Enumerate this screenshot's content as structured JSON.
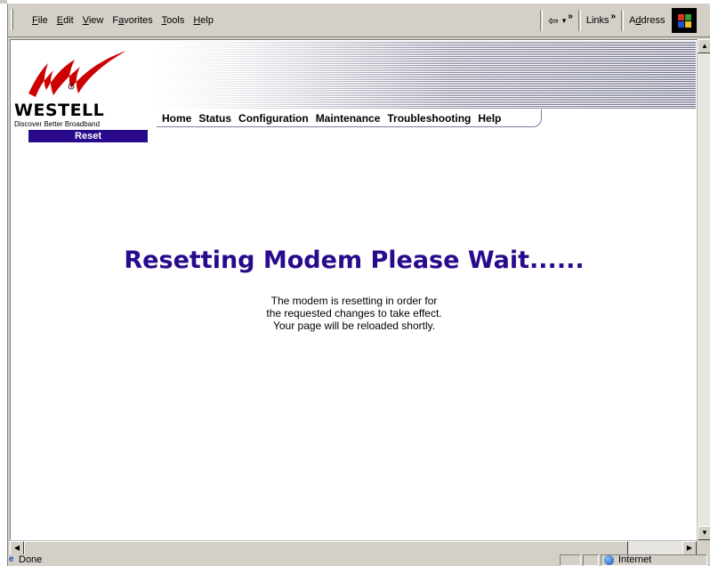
{
  "menu": {
    "items": [
      {
        "pre": "",
        "ul": "F",
        "post": "ile"
      },
      {
        "pre": "",
        "ul": "E",
        "post": "dit"
      },
      {
        "pre": "",
        "ul": "V",
        "post": "iew"
      },
      {
        "pre": "F",
        "ul": "a",
        "post": "vorites"
      },
      {
        "pre": "",
        "ul": "T",
        "post": "ools"
      },
      {
        "pre": "",
        "ul": "H",
        "post": "elp"
      }
    ]
  },
  "toolbar": {
    "back_arrow": "⇦",
    "dropdown_arrow": "▾",
    "chevron": "»",
    "links_label": "Links",
    "address_pre": "A",
    "address_ul": "d",
    "address_post": "dress"
  },
  "page": {
    "brand": "WESTELL",
    "tagline": "Discover  Better  Broadband",
    "section_label": "Reset",
    "nav": [
      "Home",
      "Status",
      "Configuration",
      "Maintenance",
      "Troubleshooting",
      "Help"
    ],
    "heading": "Resetting Modem Please Wait......",
    "message_lines": [
      "The modem is resetting in order for",
      "the requested changes to take effect.",
      "Your page will be reloaded shortly."
    ]
  },
  "statusbar": {
    "status": "Done",
    "zone": "Internet"
  },
  "colors": {
    "brand_purple": "#2a0a8c",
    "logo_red": "#cc0000",
    "chrome": "#d4d0c8"
  },
  "icons": {
    "back": "back-arrow-icon",
    "windows": "windows-logo-icon",
    "zone": "globe-icon",
    "page": "ie-page-icon"
  }
}
